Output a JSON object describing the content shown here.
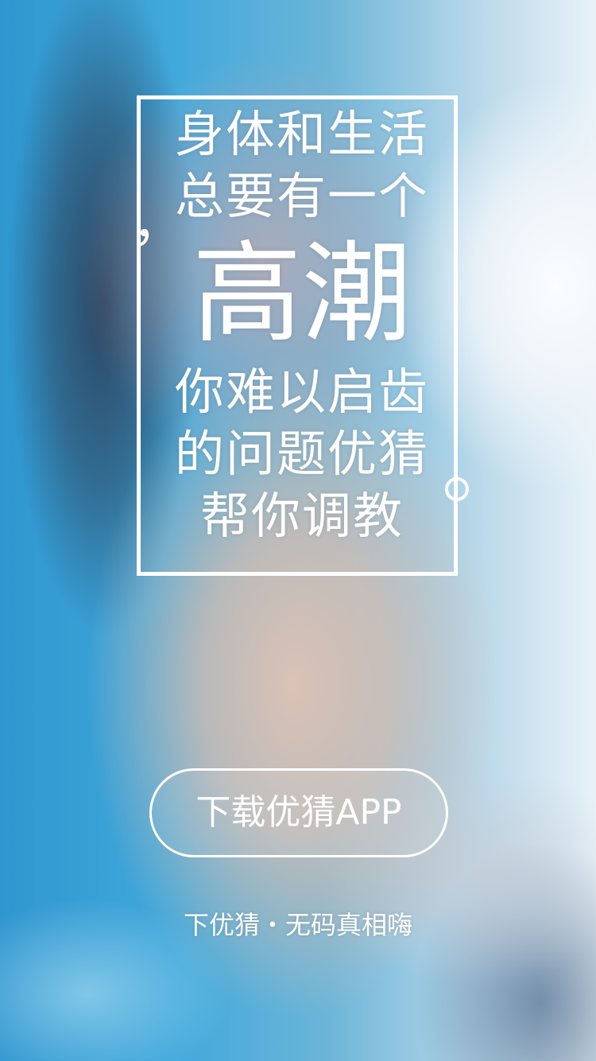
{
  "headline": {
    "line1": "身体和生活",
    "line2": "总要有一个",
    "line3": "高潮",
    "line4": "你难以启齿",
    "line5": "的问题优猜",
    "line6": "帮你调教",
    "comma": "，"
  },
  "cta": {
    "download_label": "下载优猜APP"
  },
  "footer": {
    "tagline": "下优猜・无码真相嗨"
  },
  "colors": {
    "text": "#ffffff",
    "background_accent": "#3e9fd0"
  }
}
